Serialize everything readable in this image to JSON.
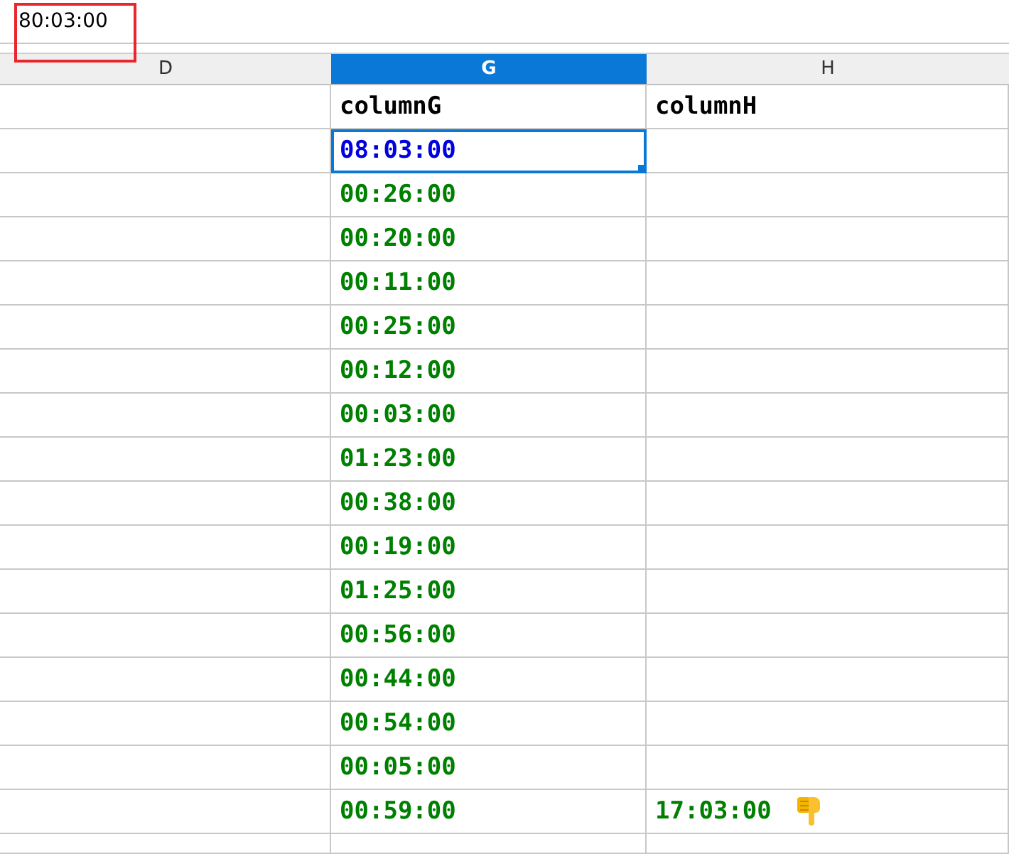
{
  "formula_bar": {
    "value": "80:03:00",
    "highlighted": true
  },
  "columns": [
    {
      "label": "D",
      "selected": false
    },
    {
      "label": "G",
      "selected": true
    },
    {
      "label": "H",
      "selected": false
    }
  ],
  "rows": [
    {
      "g": {
        "text": "columnG",
        "kind": "header",
        "selected": false
      },
      "h": {
        "text": "columnH",
        "kind": "header"
      }
    },
    {
      "g": {
        "text": "08:03:00",
        "kind": "time",
        "selected": true
      }
    },
    {
      "g": {
        "text": "00:26:00",
        "kind": "time",
        "selected": false
      }
    },
    {
      "g": {
        "text": "00:20:00",
        "kind": "time",
        "selected": false
      }
    },
    {
      "g": {
        "text": "00:11:00",
        "kind": "time",
        "selected": false
      }
    },
    {
      "g": {
        "text": "00:25:00",
        "kind": "time",
        "selected": false
      }
    },
    {
      "g": {
        "text": "00:12:00",
        "kind": "time",
        "selected": false
      }
    },
    {
      "g": {
        "text": "00:03:00",
        "kind": "time",
        "selected": false
      }
    },
    {
      "g": {
        "text": "01:23:00",
        "kind": "time",
        "selected": false
      }
    },
    {
      "g": {
        "text": "00:38:00",
        "kind": "time",
        "selected": false
      }
    },
    {
      "g": {
        "text": "00:19:00",
        "kind": "time",
        "selected": false
      }
    },
    {
      "g": {
        "text": "01:25:00",
        "kind": "time",
        "selected": false
      }
    },
    {
      "g": {
        "text": "00:56:00",
        "kind": "time",
        "selected": false
      }
    },
    {
      "g": {
        "text": "00:44:00",
        "kind": "time",
        "selected": false
      }
    },
    {
      "g": {
        "text": "00:54:00",
        "kind": "time",
        "selected": false
      }
    },
    {
      "g": {
        "text": "00:05:00",
        "kind": "time",
        "selected": false
      }
    },
    {
      "g": {
        "text": "00:59:00",
        "kind": "time",
        "selected": false
      },
      "h": {
        "text": "17:03:00",
        "kind": "flagged"
      }
    }
  ]
}
